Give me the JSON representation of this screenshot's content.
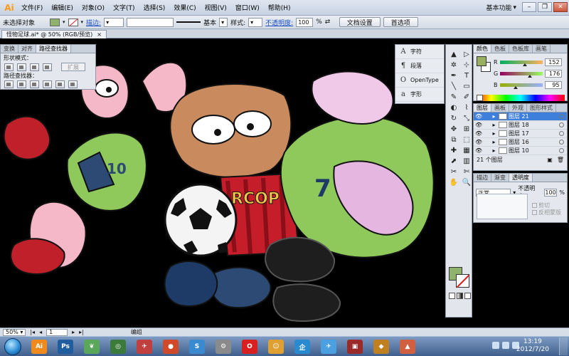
{
  "app": {
    "logo": "Ai",
    "workspace_label": "基本功能",
    "minimize": "–",
    "restore": "❐",
    "close": "✕"
  },
  "menu": [
    "文件(F)",
    "编辑(E)",
    "对象(O)",
    "文字(T)",
    "选择(S)",
    "效果(C)",
    "视图(V)",
    "窗口(W)",
    "帮助(H)"
  ],
  "control_bar": {
    "selection_status": "未选择对象",
    "fill_color": "#8fb26c",
    "stroke_label": "描边:",
    "stroke_style": "基本",
    "style_label": "样式:",
    "opacity_label": "不透明度:",
    "opacity_value": "100",
    "opacity_unit": "%",
    "doc_setup_button": "文档设置",
    "preferences_button": "首选项"
  },
  "document": {
    "tab_title": "怪物足球.ai* @ 50% (RGB/预览)",
    "close": "×"
  },
  "pathfinder_panel": {
    "tabs": [
      "变换",
      "对齐",
      "路径查找器"
    ],
    "shape_modes_label": "形状模式：",
    "pathfinders_label": "路径查找器：",
    "expand_button": "扩展"
  },
  "type_panel": {
    "items": [
      {
        "glyph": "A",
        "label": "字符"
      },
      {
        "glyph": "¶",
        "label": "段落"
      },
      {
        "glyph": "O",
        "label": "OpenType"
      },
      {
        "glyph": "a",
        "label": "字形"
      }
    ]
  },
  "tools": [
    "▲",
    "▷",
    "✲",
    "⊹",
    "✒",
    "T",
    "╲",
    "▭",
    "✎",
    "✐",
    "◐",
    "⌇",
    "↻",
    "⤡",
    "✥",
    "⊞",
    "⧉",
    "⬚",
    "✚",
    "▦",
    "⬈",
    "▥",
    "✂",
    "✄",
    "✋",
    "🔍"
  ],
  "color_panel": {
    "tabs": [
      "颜色",
      "色板",
      "色板库",
      "画笔"
    ],
    "fill_color": "#98b05f",
    "channels": [
      {
        "name": "R",
        "value": "152",
        "pos": 0.596,
        "gradient": "linear-gradient(90deg,#00b05f,#ffb05f)"
      },
      {
        "name": "G",
        "value": "176",
        "pos": 0.69,
        "gradient": "linear-gradient(90deg,#98005f,#98ff5f)"
      },
      {
        "name": "B",
        "value": "95",
        "pos": 0.373,
        "gradient": "linear-gradient(90deg,#98b000,#98b0ff)"
      }
    ]
  },
  "layers_panel": {
    "tabs": [
      "图层",
      "画板",
      "外观",
      "图形样式"
    ],
    "layers": [
      {
        "name": "图层 21",
        "selected": true
      },
      {
        "name": "图层 18",
        "selected": false
      },
      {
        "name": "图层 17",
        "selected": false
      },
      {
        "name": "图层 16",
        "selected": false
      },
      {
        "name": "图层 10",
        "selected": false
      }
    ],
    "footer": "21 个图层"
  },
  "transparency_panel": {
    "tabs": [
      "描边",
      "渐变",
      "透明度"
    ],
    "blend_mode": "正常",
    "opacity_label": "不透明度:",
    "opacity_value": "100",
    "opacity_unit": "%",
    "clip_label": "剪切",
    "invert_mask_label": "反相蒙版"
  },
  "canvas_art": {
    "jersey_text": "RCOP",
    "jersey_number": "7",
    "shorts_number": "10"
  },
  "status_bar": {
    "zoom": "50%",
    "artboard": "1",
    "tool_name": "编组"
  },
  "taskbar": {
    "time": "13:19",
    "date": "2012/7/20",
    "apps": [
      {
        "label": "Ai",
        "color": "#f08a1c"
      },
      {
        "label": "Ps",
        "color": "#1f5d9f"
      },
      {
        "label": "❦",
        "color": "#5aa65a"
      },
      {
        "label": "◎",
        "color": "#3a7a3a"
      },
      {
        "label": "✈",
        "color": "#c04040"
      },
      {
        "label": "●",
        "color": "#d04a2a"
      },
      {
        "label": "S",
        "color": "#3a8ad0"
      },
      {
        "label": "⚙",
        "color": "#8a8a8a"
      },
      {
        "label": "O",
        "color": "#d82020"
      },
      {
        "label": "☺",
        "color": "#e0a030"
      },
      {
        "label": "企",
        "color": "#2a8ad0"
      },
      {
        "label": "✈",
        "color": "#4aa0e0"
      },
      {
        "label": "▣",
        "color": "#9a2a2a"
      },
      {
        "label": "◆",
        "color": "#c08020"
      },
      {
        "label": "▲",
        "color": "#d06040"
      }
    ]
  }
}
